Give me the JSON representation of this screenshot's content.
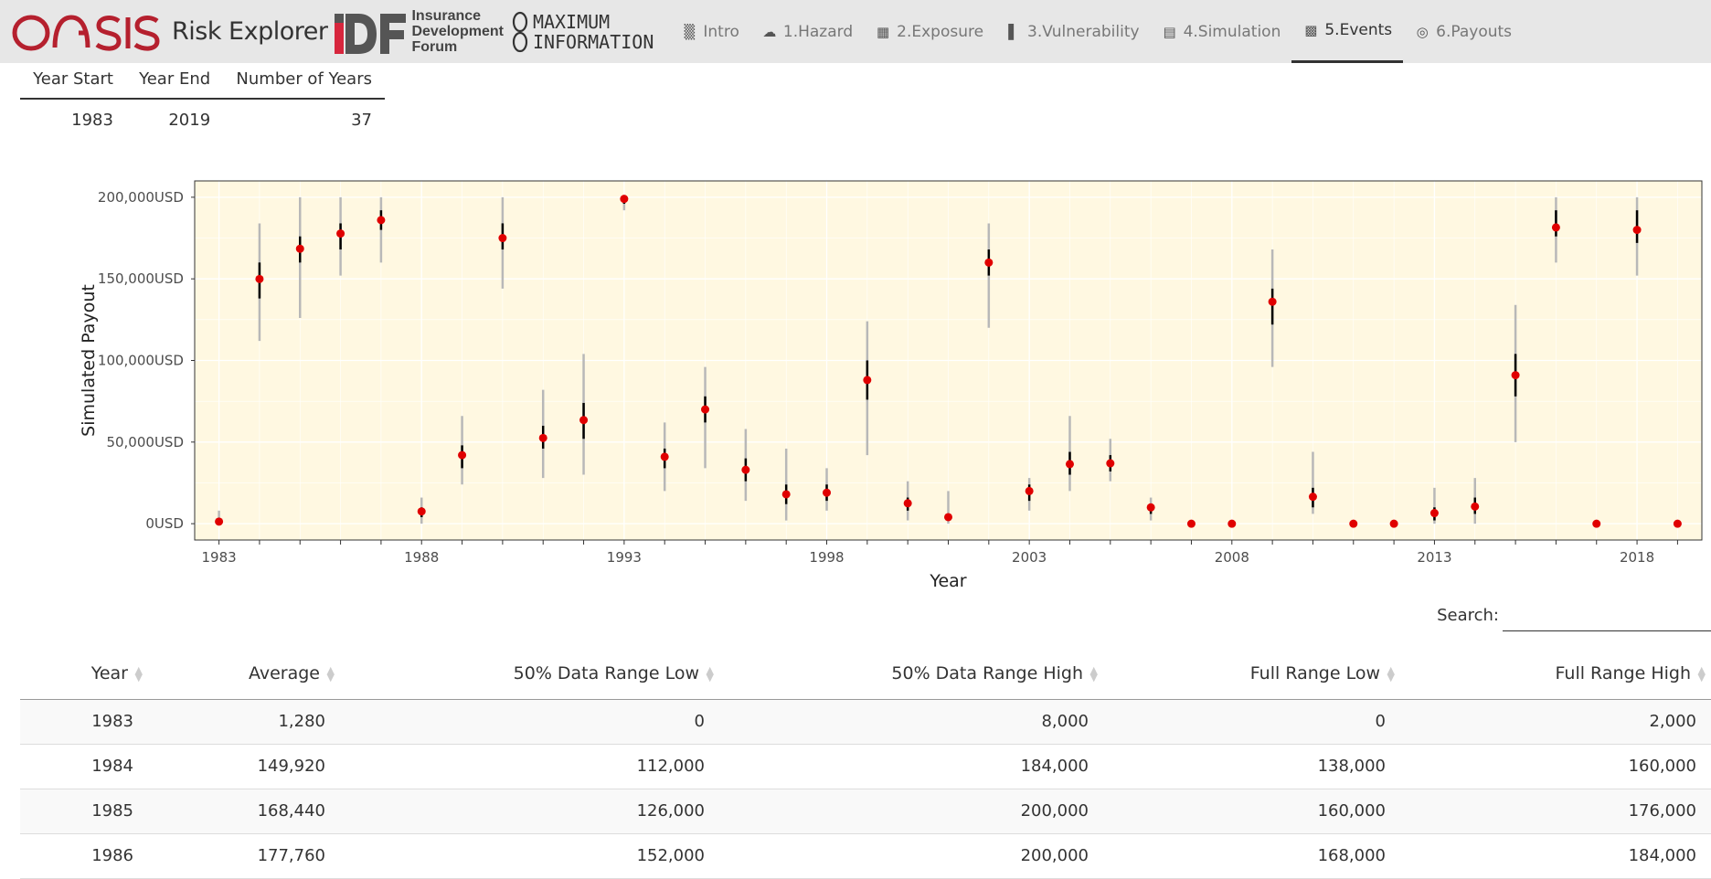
{
  "app": {
    "brand_logo": "OASIS",
    "brand_text": "Risk Explorer",
    "idf_logo_text": "Insurance Development Forum",
    "mi_logo_text": "MAXIMUM INFORMATION"
  },
  "nav": {
    "tabs": [
      {
        "label": "Intro",
        "icon": "building-icon",
        "active": false
      },
      {
        "label": "1.Hazard",
        "icon": "cloud-rain-icon",
        "active": false
      },
      {
        "label": "2.Exposure",
        "icon": "building-grid-icon",
        "active": false
      },
      {
        "label": "3.Vulnerability",
        "icon": "crumbling-building-icon",
        "active": false
      },
      {
        "label": "4.Simulation",
        "icon": "calculator-icon",
        "active": false
      },
      {
        "label": "5.Events",
        "icon": "bar-chart-icon",
        "active": true
      },
      {
        "label": "6.Payouts",
        "icon": "target-icon",
        "active": false
      }
    ]
  },
  "summary": {
    "headers": [
      "Year Start",
      "Year End",
      "Number of Years"
    ],
    "row": [
      "1983",
      "2019",
      "37"
    ]
  },
  "chart_data": {
    "type": "scatter",
    "xlabel": "Year",
    "ylabel": "Simulated Payout",
    "xlim": [
      1982.4,
      2019.6
    ],
    "ylim": [
      -10000,
      210000
    ],
    "x_ticks": [
      1983,
      1988,
      1993,
      1998,
      2003,
      2008,
      2013,
      2018
    ],
    "y_ticks": [
      0,
      50000,
      100000,
      150000,
      200000
    ],
    "y_tick_labels": [
      "0USD",
      "50,000USD",
      "100,000USD",
      "150,000USD",
      "200,000USD"
    ],
    "background": "#fff8e1",
    "grid": true,
    "point_color": "#e00000",
    "years": [
      1983,
      1984,
      1985,
      1986,
      1987,
      1988,
      1989,
      1990,
      1991,
      1992,
      1993,
      1994,
      1995,
      1996,
      1997,
      1998,
      1999,
      2000,
      2001,
      2002,
      2003,
      2004,
      2005,
      2006,
      2007,
      2008,
      2009,
      2010,
      2011,
      2012,
      2013,
      2014,
      2015,
      2016,
      2017,
      2018,
      2019
    ],
    "average": [
      1280,
      149920,
      168440,
      177760,
      186000,
      7500,
      42000,
      175000,
      52500,
      63500,
      199000,
      41000,
      70000,
      33000,
      18000,
      19000,
      88000,
      12500,
      4000,
      160000,
      20000,
      36500,
      37000,
      10000,
      0,
      0,
      136000,
      16500,
      0,
      0,
      6500,
      10500,
      91000,
      181500,
      0,
      180000,
      0
    ],
    "full_low": [
      0,
      112000,
      126000,
      152000,
      160000,
      0,
      24000,
      144000,
      28000,
      30000,
      192000,
      20000,
      34000,
      14000,
      2000,
      8000,
      42000,
      2000,
      0,
      120000,
      8000,
      20000,
      26000,
      2000,
      0,
      0,
      96000,
      6000,
      0,
      0,
      0,
      0,
      50000,
      160000,
      0,
      152000,
      0
    ],
    "full_high": [
      8000,
      184000,
      200000,
      200000,
      200000,
      16000,
      66000,
      200000,
      82000,
      104000,
      200000,
      62000,
      96000,
      58000,
      46000,
      34000,
      124000,
      26000,
      20000,
      184000,
      28000,
      66000,
      52000,
      16000,
      0,
      0,
      168000,
      44000,
      0,
      0,
      22000,
      28000,
      134000,
      200000,
      0,
      200000,
      0
    ],
    "mid_low": [
      0,
      138000,
      160000,
      168000,
      180000,
      4000,
      34000,
      168000,
      46000,
      52000,
      196000,
      34000,
      62000,
      26000,
      12000,
      14000,
      76000,
      8000,
      2000,
      152000,
      14000,
      30000,
      32000,
      6000,
      0,
      0,
      122000,
      10000,
      0,
      0,
      2000,
      6000,
      78000,
      176000,
      0,
      172000,
      0
    ],
    "mid_high": [
      2000,
      160000,
      176000,
      184000,
      192000,
      10000,
      48000,
      184000,
      60000,
      74000,
      200000,
      46000,
      78000,
      40000,
      24000,
      24000,
      100000,
      16000,
      6000,
      168000,
      24000,
      44000,
      42000,
      12000,
      0,
      0,
      144000,
      22000,
      0,
      0,
      10000,
      16000,
      104000,
      192000,
      0,
      192000,
      0
    ]
  },
  "search": {
    "label": "Search:",
    "placeholder": ""
  },
  "datatable": {
    "headers": [
      "Year",
      "Average",
      "50% Data Range Low",
      "50% Data Range High",
      "Full Range Low",
      "Full Range High"
    ],
    "rows": [
      [
        "1983",
        "1,280",
        "0",
        "8,000",
        "0",
        "2,000"
      ],
      [
        "1984",
        "149,920",
        "112,000",
        "184,000",
        "138,000",
        "160,000"
      ],
      [
        "1985",
        "168,440",
        "126,000",
        "200,000",
        "160,000",
        "176,000"
      ],
      [
        "1986",
        "177,760",
        "152,000",
        "200,000",
        "168,000",
        "184,000"
      ]
    ]
  }
}
